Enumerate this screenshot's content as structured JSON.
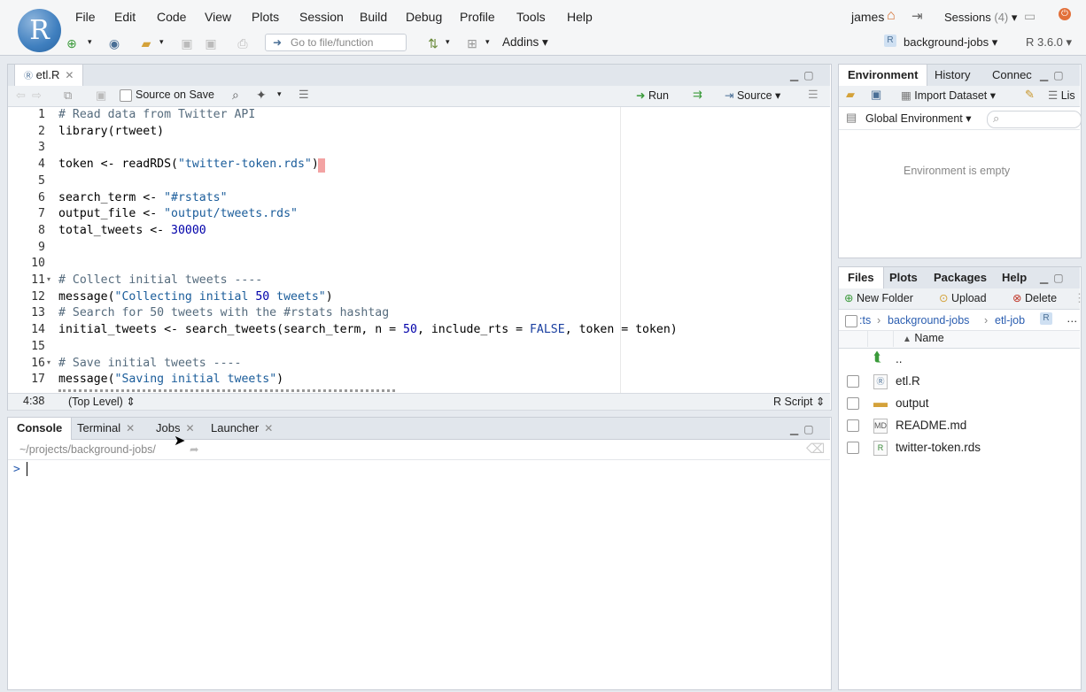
{
  "app": {
    "logo_letter": "R"
  },
  "menu": [
    "File",
    "Edit",
    "Code",
    "View",
    "Plots",
    "Session",
    "Build",
    "Debug",
    "Profile",
    "Tools",
    "Help"
  ],
  "user": {
    "name": "james",
    "sessions_label": "Sessions",
    "sessions_count": "(4)"
  },
  "toolbar": {
    "goto_placeholder": "Go to file/function",
    "addins_label": "Addins",
    "project_label": "background-jobs",
    "r_version": "R 3.6.0"
  },
  "editor": {
    "tab_label": "etl.R",
    "source_on_save": "Source on Save",
    "run_label": "Run",
    "source_label": "Source",
    "line_numbers": [
      "1",
      "2",
      "3",
      "4",
      "5",
      "6",
      "7",
      "8",
      "9",
      "10",
      "11",
      "12",
      "13",
      "14",
      "15",
      "16",
      "17"
    ],
    "lines": [
      "# Read data from Twitter API",
      "library(rtweet)",
      "",
      "token <- readRDS(\"twitter-token.rds\")",
      "",
      "search_term <- \"#rstats\"",
      "output_file <- \"output/tweets.rds\"",
      "total_tweets <- 30000",
      "",
      "",
      "# Collect initial tweets ----",
      "message(\"Collecting initial 50 tweets\")",
      "# Search for 50 tweets with the #rstats hashtag",
      "initial_tweets <- search_tweets(search_term, n = 50, include_rts = FALSE, token = token)",
      "",
      "# Save initial tweets ----",
      "message(\"Saving initial tweets\")"
    ],
    "status_position": "4:38",
    "status_scope": "(Top Level)",
    "status_type": "R Script"
  },
  "console": {
    "tabs": [
      "Console",
      "Terminal",
      "Jobs",
      "Launcher"
    ],
    "path": "~/projects/background-jobs/",
    "prompt": ">"
  },
  "environment": {
    "tabs": [
      "Environment",
      "History",
      "Connec"
    ],
    "import_label": "Import Dataset",
    "list_label": "Lis",
    "scope_label": "Global Environment",
    "empty_message": "Environment is empty"
  },
  "files": {
    "tabs": [
      "Files",
      "Plots",
      "Packages",
      "Help"
    ],
    "new_folder": "New Folder",
    "upload": "Upload",
    "delete": "Delete",
    "breadcrumb": [
      ":ts",
      "background-jobs",
      "etl-job"
    ],
    "column_name": "Name",
    "up_label": "..",
    "items": [
      {
        "name": "etl.R",
        "icon": "r-file-icon"
      },
      {
        "name": "output",
        "icon": "folder-icon"
      },
      {
        "name": "README.md",
        "icon": "markdown-file-icon"
      },
      {
        "name": "twitter-token.rds",
        "icon": "rds-file-icon"
      }
    ]
  },
  "colors": {
    "accent": "#4a6f96",
    "pane_bg": "#ffffff",
    "chrome_bg": "#e6eaef",
    "tab_bg": "#e1e6ec"
  }
}
